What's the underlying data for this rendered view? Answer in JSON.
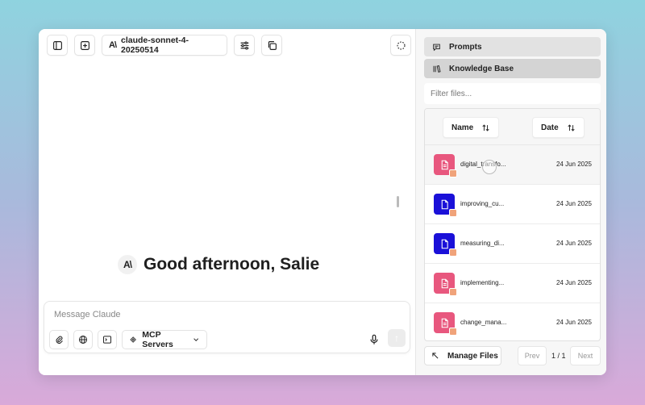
{
  "toolbar": {
    "model_name": "claude-sonnet-4-20250514",
    "model_logo": "A\\"
  },
  "greeting": {
    "logo": "A\\",
    "text": "Good afternoon, Salie"
  },
  "composer": {
    "placeholder": "Message Claude",
    "mcp_label": "MCP Servers",
    "send_glyph": "↑"
  },
  "panel": {
    "nav": [
      {
        "label": "Prompts",
        "icon": "chat-bubble-icon"
      },
      {
        "label": "Knowledge Base",
        "icon": "books-icon"
      }
    ],
    "filter_placeholder": "Filter files...",
    "columns": {
      "name": "Name",
      "date": "Date"
    },
    "files": [
      {
        "name": "digital_transfo...",
        "date": "24 Jun 2025",
        "color": "#e8577e"
      },
      {
        "name": "improving_cu...",
        "date": "24 Jun 2025",
        "color": "#1a10d8"
      },
      {
        "name": "measuring_di...",
        "date": "24 Jun 2025",
        "color": "#1a10d8"
      },
      {
        "name": "implementing...",
        "date": "24 Jun 2025",
        "color": "#e8577e"
      },
      {
        "name": "change_mana...",
        "date": "24 Jun 2025",
        "color": "#e8577e"
      }
    ],
    "footer": {
      "manage_label": "Manage Files",
      "prev_label": "Prev",
      "page_count": "1 / 1",
      "next_label": "Next"
    }
  }
}
